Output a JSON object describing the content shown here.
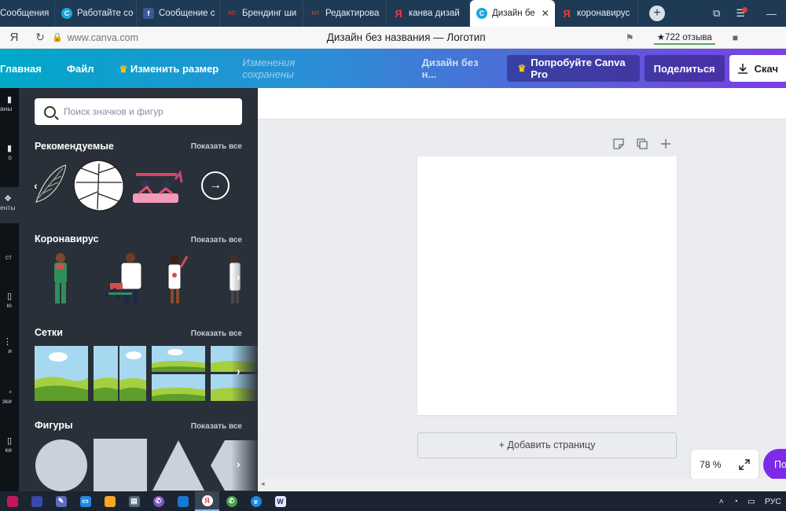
{
  "browser": {
    "tabs": [
      {
        "label": "Сообщения",
        "icon": "vk-icon",
        "color": "#4a76a8",
        "active": false
      },
      {
        "label": "Работайте со",
        "icon": "canva-icon",
        "color": "#1aa7d9",
        "active": false
      },
      {
        "label": "Сообщение с",
        "icon": "facebook-icon",
        "color": "#3b5998",
        "active": false
      },
      {
        "label": "Брендинг ши",
        "icon": "kp-icon",
        "color": "#c0392b",
        "active": false
      },
      {
        "label": "Редактирова",
        "icon": "kp-icon",
        "color": "#c0392b",
        "active": false
      },
      {
        "label": "канва дизай",
        "icon": "yandex-icon",
        "color": "#ff3333",
        "active": false
      },
      {
        "label": "Дизайн бе",
        "icon": "canva-icon",
        "color": "#1aa7d9",
        "active": true
      },
      {
        "label": "коронавирус",
        "icon": "yandex-icon",
        "color": "#ff3333",
        "active": false
      }
    ],
    "new_tab": "+",
    "address": {
      "yandex_glyph": "Я",
      "reload_glyph": "↻",
      "url": "www.canva.com",
      "page_title": "Дизайн без названия — Логотип",
      "reviews": "★722 отзыва"
    }
  },
  "header": {
    "home": "Главная",
    "file": "Файл",
    "resize": "Изменить размер",
    "saved_status": "Изменения сохранены",
    "design_name": "Дизайн без н...",
    "try_pro": "Попробуйте Canva Pro",
    "share": "Поделиться",
    "download": "Скач"
  },
  "rail": {
    "items": [
      {
        "label": "аны",
        "icon": "templates-icon"
      },
      {
        "label": "о",
        "icon": "photos-icon"
      },
      {
        "label": "енты",
        "icon": "elements-icon"
      },
      {
        "label": "ст",
        "icon": "text-icon"
      },
      {
        "label": "ю",
        "icon": "video-icon"
      },
      {
        "label": "и",
        "icon": "background-icon"
      },
      {
        "label": "зки",
        "icon": "uploads-icon"
      },
      {
        "label": "ки",
        "icon": "folders-icon"
      }
    ]
  },
  "panel": {
    "search_placeholder": "Поиск значков и фигур",
    "show_all": "Показать все",
    "sections": {
      "recommended": "Рекомендуемые",
      "coronavirus": "Коронавирус",
      "grids": "Сетки",
      "shapes": "Фигуры"
    }
  },
  "canvas": {
    "add_page": "+ Добавить страницу",
    "zoom": "78 %",
    "help": "По"
  },
  "taskbar": {
    "language": "РУС"
  },
  "colors": {
    "panel_bg": "#293039",
    "rail_bg": "#0e1318",
    "accent_purple": "#7d2ae8",
    "canvas_bg": "#ebecf0"
  }
}
